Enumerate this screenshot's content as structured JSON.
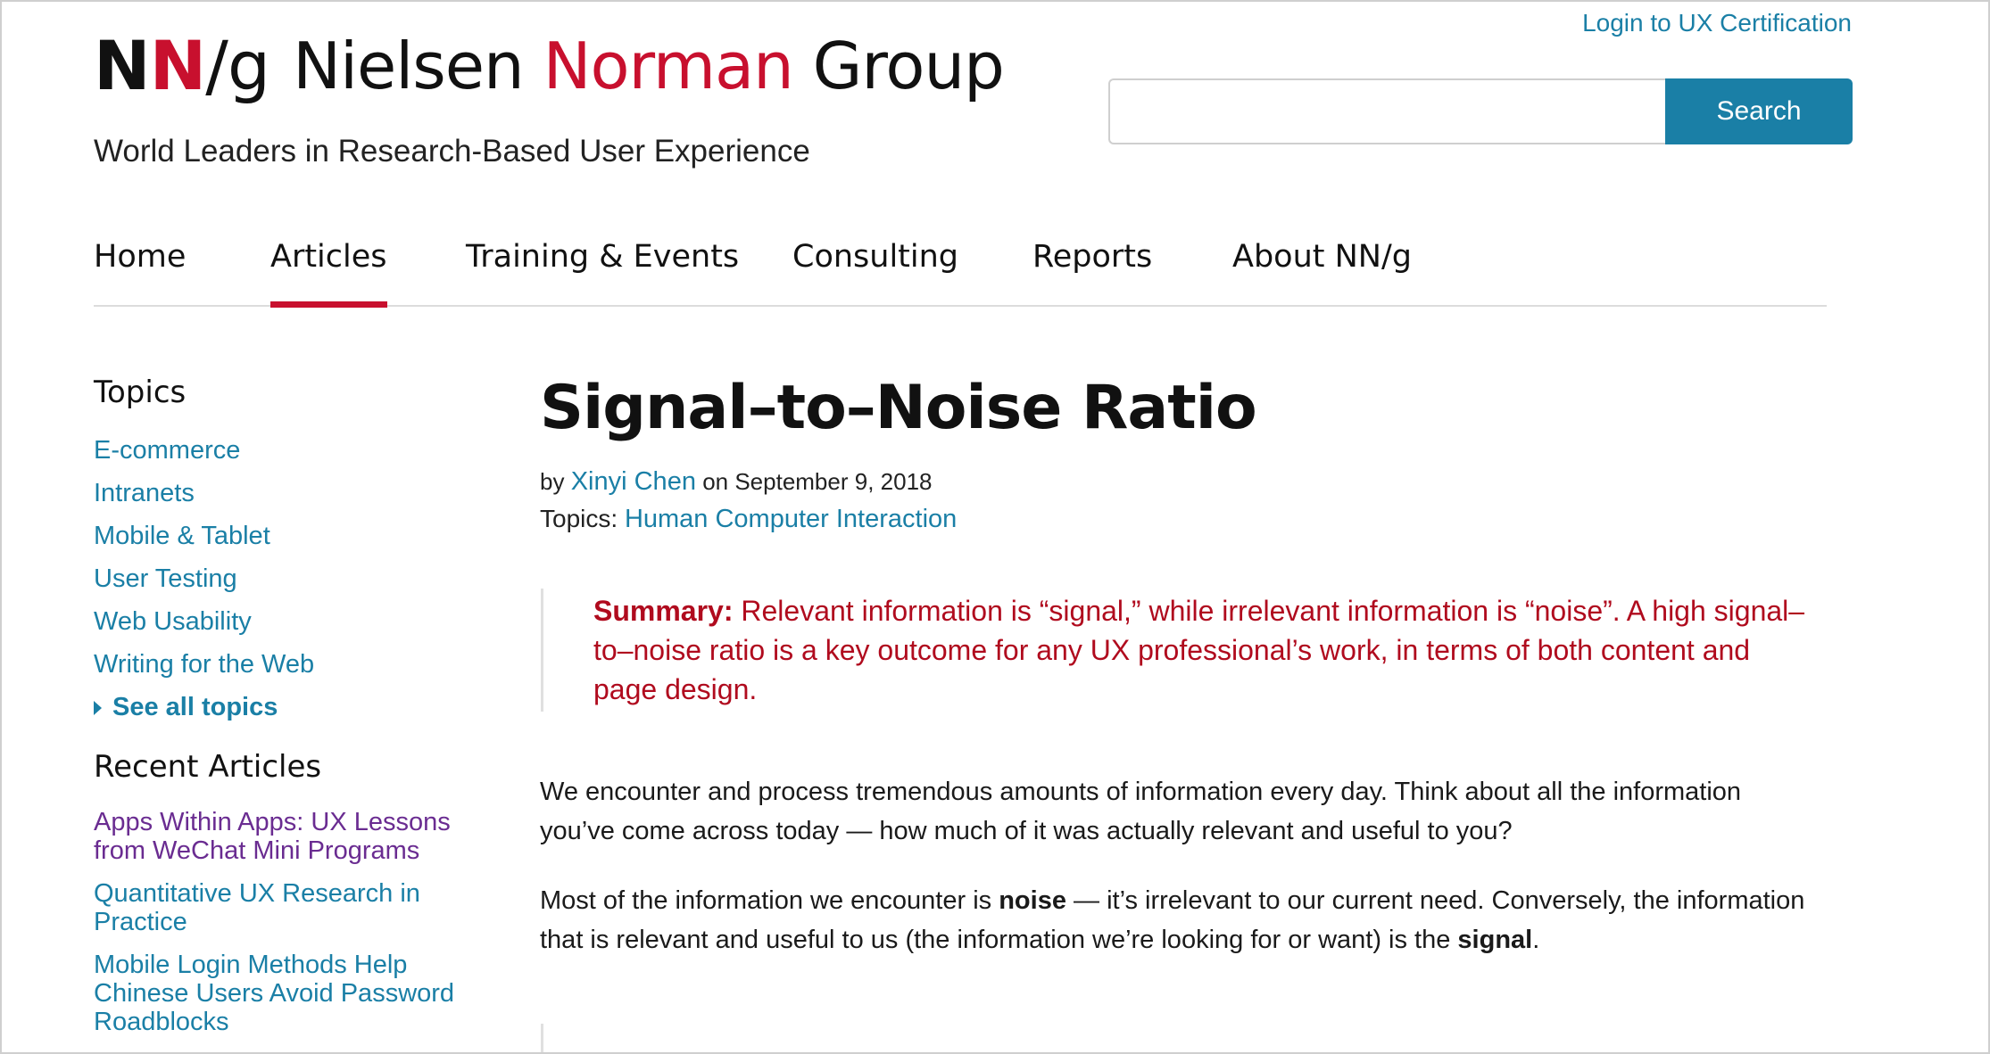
{
  "header": {
    "logo": {
      "mark_n1": "N",
      "mark_n2": "N",
      "mark_rest": "/g",
      "word_nielsen": "Nielsen",
      "word_norman": "Norman",
      "word_group": "Group"
    },
    "tagline": "World Leaders in Research-Based User Experience",
    "login_link": "Login to UX Certification",
    "search": {
      "placeholder": "",
      "button_label": "Search"
    }
  },
  "nav": {
    "items": [
      {
        "label": "Home",
        "active": false
      },
      {
        "label": "Articles",
        "active": true
      },
      {
        "label": "Training & Events",
        "active": false
      },
      {
        "label": "Consulting",
        "active": false
      },
      {
        "label": "Reports",
        "active": false
      },
      {
        "label": "About NN/g",
        "active": false
      }
    ]
  },
  "sidebar": {
    "topics_heading": "Topics",
    "topics": [
      "E-commerce",
      "Intranets",
      "Mobile & Tablet",
      "User Testing",
      "Web Usability",
      "Writing for the Web"
    ],
    "see_all": "See all topics",
    "recent_heading": "Recent Articles",
    "recent": [
      {
        "title": "Apps Within Apps: UX Lessons from WeChat Mini Programs",
        "visited": true
      },
      {
        "title": "Quantitative UX Research in Practice",
        "visited": false
      },
      {
        "title": "Mobile Login Methods Help Chinese Users Avoid Password Roadblocks",
        "visited": false
      }
    ]
  },
  "article": {
    "title": "Signal–to–Noise Ratio",
    "by_prefix": "by",
    "author": "Xinyi Chen",
    "date_text": "on September 9, 2018",
    "topics_prefix": "Topics:",
    "topic": "Human Computer Interaction",
    "summary_label": "Summary:",
    "summary_text": "Relevant information is “signal,” while irrelevant information is “noise”. A high signal–to–noise ratio is a key outcome for any UX professional’s work, in terms of both content and page design.",
    "para1": "We encounter and process tremendous amounts of information every day. Think about all the information you’ve come across today — how much of it was actually relevant and useful to you?",
    "para2_a": "Most of the information we encounter is",
    "para2_bold1": "noise",
    "para2_b": "— it’s irrelevant to our current need. Conversely, the information that is relevant and useful to us (the information we’re looking for or want) is the",
    "para2_bold2": "signal",
    "para2_end": "."
  },
  "colors": {
    "brand_red": "#c8102e",
    "link_blue": "#1a7fa6",
    "visited_purple": "#6a2c91",
    "summary_red": "#b00b1e"
  }
}
